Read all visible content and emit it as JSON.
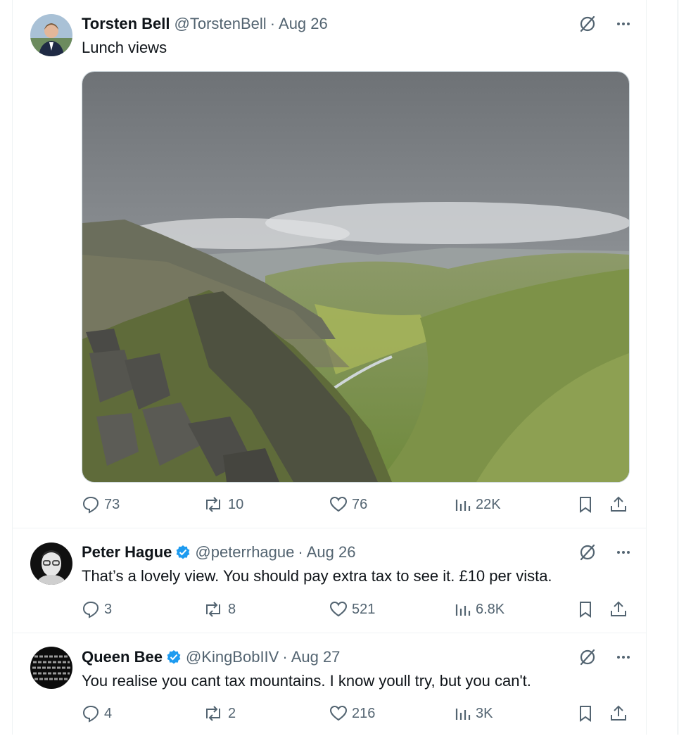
{
  "tweets": [
    {
      "name": "Torsten Bell",
      "handle": "@TorstenBell",
      "dot": "·",
      "date": "Aug 26",
      "text": "Lunch views",
      "verified": false,
      "stats": {
        "replies": "73",
        "reposts": "10",
        "likes": "76",
        "views": "22K"
      }
    },
    {
      "name": "Peter Hague",
      "handle": "@peterrhague",
      "dot": "·",
      "date": "Aug 26",
      "text": "That’s a lovely view. You should pay extra tax to see it. £10 per vista.",
      "verified": true,
      "stats": {
        "replies": "3",
        "reposts": "8",
        "likes": "521",
        "views": "6.8K"
      }
    },
    {
      "name": "Queen Bee",
      "handle": "@KingBobIIV",
      "dot": "·",
      "date": "Aug 27",
      "text": "You realise you cant tax mountains. I know youll try, but you can't.",
      "verified": true,
      "stats": {
        "replies": "4",
        "reposts": "2",
        "likes": "216",
        "views": "3K"
      }
    }
  ],
  "colors": {
    "verified": "#1d9bf0",
    "muted": "#536471",
    "text": "#0f1419",
    "border": "#eff3f4"
  },
  "icons": [
    "grok-icon",
    "more-icon",
    "reply-icon",
    "repost-icon",
    "like-icon",
    "views-icon",
    "bookmark-icon",
    "share-icon",
    "verified-badge-icon"
  ]
}
